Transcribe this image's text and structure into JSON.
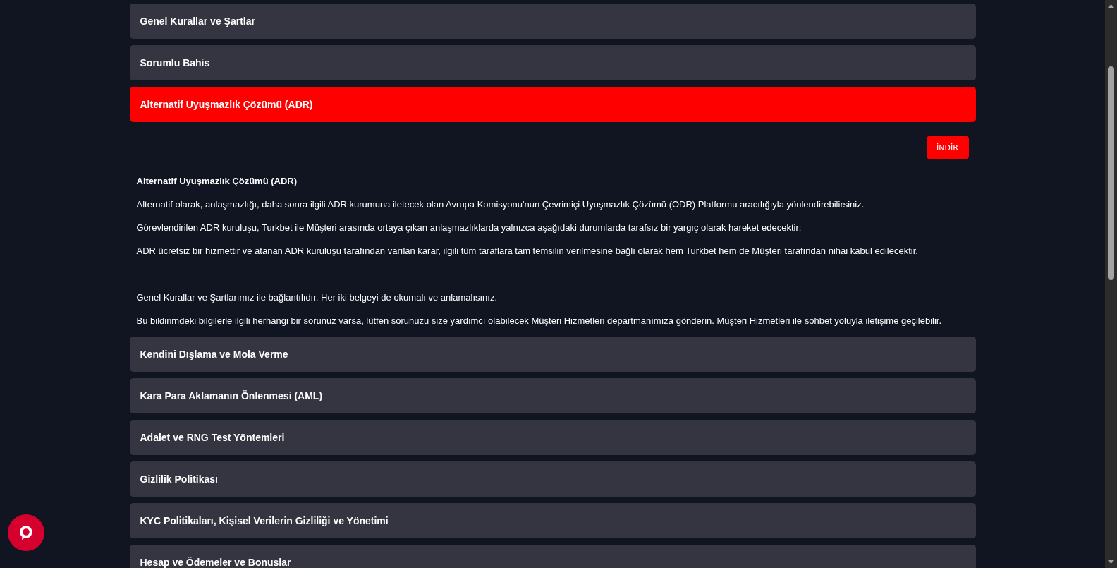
{
  "accordion": [
    {
      "title": "Genel Kurallar ve Şartlar",
      "expanded": false
    },
    {
      "title": "Sorumlu Bahis",
      "expanded": false
    },
    {
      "title": "Alternatif Uyuşmazlık Çözümü (ADR)",
      "expanded": true,
      "download_button": "İNDİR",
      "content": {
        "heading": "Alternatif Uyuşmazlık Çözümü (ADR)",
        "blocks": [
          [
            "Alternatif olarak, anlaşmazlığı, daha sonra ilgili ADR kurumuna iletecek olan Avrupa Komisyonu'nun Çevrimiçi Uyuşmazlık Çözümü (ODR) Platformu aracılığıyla yönlendirebilirsiniz.",
            "Görevlendirilen ADR kuruluşu, Turkbet ile Müşteri arasında ortaya çıkan anlaşmazlıklarda yalnızca aşağıdaki durumlarda tarafsız bir yargıç olarak hareket edecektir:",
            "ADR ücretsiz bir hizmettir ve atanan ADR kuruluşu tarafından varılan karar, ilgili tüm taraflara tam temsilin verilmesine bağlı olarak hem Turkbet hem de Müşteri tarafından nihai kabul edilecektir."
          ],
          [
            "Genel Kurallar ve Şartlarımız ile bağlantılıdır. Her iki belgeyi de okumalı ve anlamalısınız.",
            "Bu bildirimdeki bilgilerle ilgili herhangi bir sorunuz varsa, lütfen sorunuzu size yardımcı olabilecek Müşteri Hizmetleri departmanımıza gönderin. Müşteri Hizmetleri ile sohbet yoluyla iletişime geçilebilir."
          ]
        ]
      }
    },
    {
      "title": "Kendini Dışlama ve Mola Verme",
      "expanded": false
    },
    {
      "title": "Kara Para Aklamanın Önlenmesi (AML)",
      "expanded": false
    },
    {
      "title": "Adalet ve RNG Test Yöntemleri",
      "expanded": false
    },
    {
      "title": "Gizlilik Politikası",
      "expanded": false
    },
    {
      "title": "KYC Politikaları, Kişisel Verilerin Gizliliği ve Yönetimi",
      "expanded": false
    },
    {
      "title": "Hesap ve Ödemeler ve Bonuslar",
      "expanded": false
    }
  ]
}
